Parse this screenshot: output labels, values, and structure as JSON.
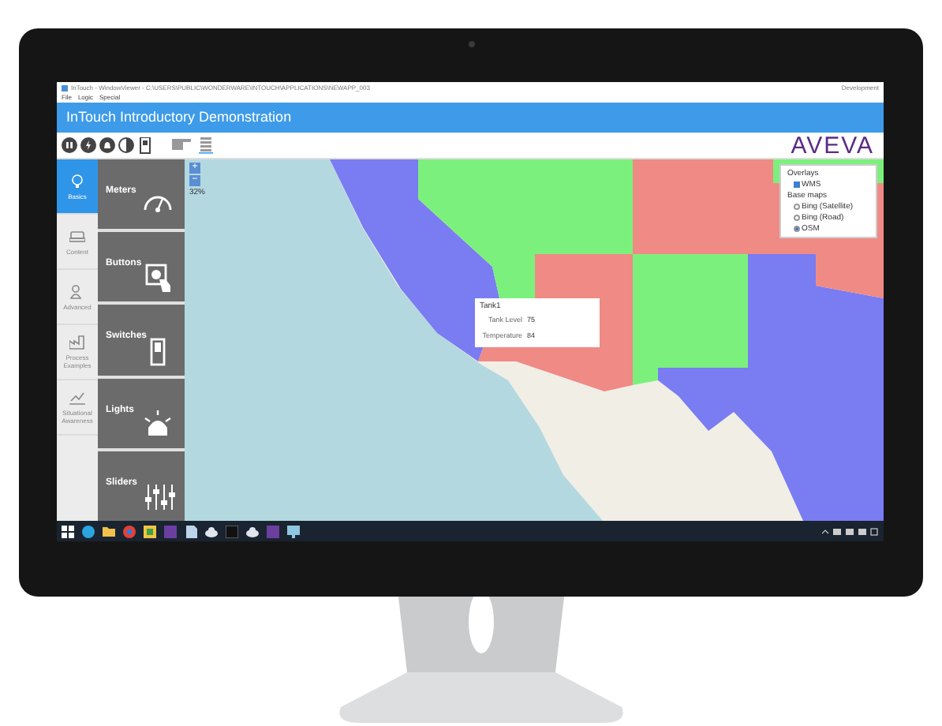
{
  "window": {
    "title": "InTouch - WindowViewer - C:\\USERS\\PUBLIC\\WONDERWARE\\INTOUCH\\APPLICATIONS\\NEWAPP_003",
    "mode": "Development"
  },
  "menu": [
    "File",
    "Logic",
    "Special"
  ],
  "header": {
    "title": "InTouch Introductory Demonstration"
  },
  "toolbar": {
    "buttons": [
      {
        "kind": "pause"
      },
      {
        "kind": "bolt"
      },
      {
        "kind": "bell"
      },
      {
        "kind": "contrast"
      },
      {
        "kind": "switch"
      },
      {
        "kind": "flag"
      },
      {
        "kind": "list"
      }
    ],
    "logo": "AVEVA"
  },
  "nav": [
    {
      "label": "Basics",
      "kind": "bulb",
      "selected": true
    },
    {
      "label": "Content",
      "kind": "sofa",
      "selected": false
    },
    {
      "label": "Advanced",
      "kind": "people",
      "selected": false
    },
    {
      "label": "Process Examples",
      "kind": "factory",
      "selected": false
    },
    {
      "label": "Situational Awareness",
      "kind": "trend",
      "selected": false
    }
  ],
  "tiles": [
    {
      "label": "Meters",
      "kind": "gauge"
    },
    {
      "label": "Buttons",
      "kind": "press"
    },
    {
      "label": "Switches",
      "kind": "switch"
    },
    {
      "label": "Lights",
      "kind": "light"
    },
    {
      "label": "Sliders",
      "kind": "sliders"
    }
  ],
  "map": {
    "zoom_in": "+",
    "zoom_out": "−",
    "zoom_level": "32%",
    "popup": {
      "title": "Tank1",
      "fields": [
        {
          "label": "Tank Level",
          "value": "75"
        },
        {
          "label": "Temperature",
          "value": "84"
        }
      ]
    },
    "layers": {
      "overlays_title": "Overlays",
      "overlays": [
        {
          "label": "WMS",
          "checked": true
        }
      ],
      "base_title": "Base maps",
      "base_maps": [
        {
          "label": "Bing (Satellite)",
          "selected": false
        },
        {
          "label": "Bing (Road)",
          "selected": false
        },
        {
          "label": "OSM",
          "selected": true
        }
      ]
    }
  },
  "taskbar": {
    "apps": [
      {
        "kind": "windows"
      },
      {
        "kind": "edge"
      },
      {
        "kind": "folder"
      },
      {
        "kind": "chrome"
      },
      {
        "kind": "paint"
      },
      {
        "kind": "purple"
      },
      {
        "kind": "doc"
      },
      {
        "kind": "cloud"
      },
      {
        "kind": "terminal"
      },
      {
        "kind": "cloud"
      },
      {
        "kind": "purple"
      },
      {
        "kind": "screen"
      }
    ]
  }
}
